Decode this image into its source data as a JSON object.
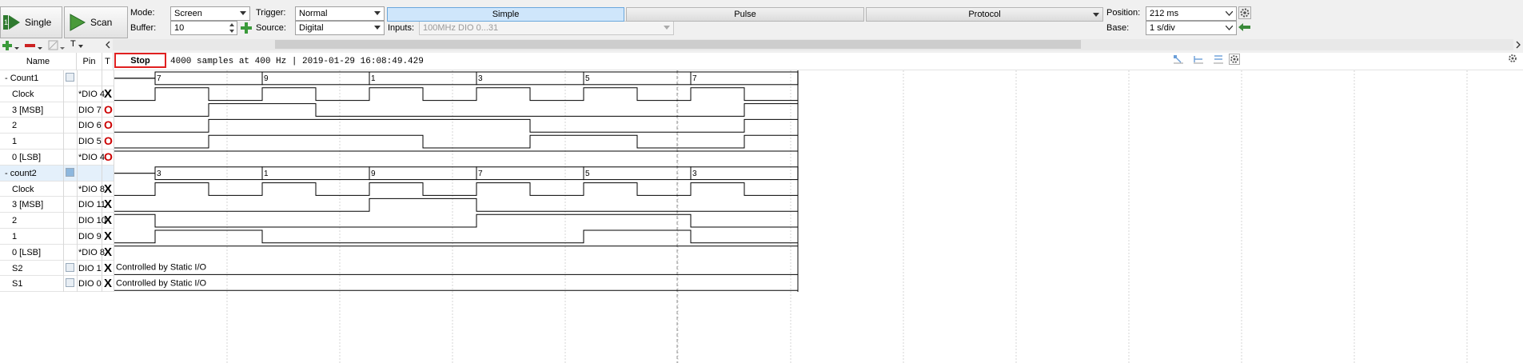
{
  "toolbar": {
    "single_label": "Single",
    "scan_label": "Scan",
    "mode_label": "Mode:",
    "mode_value": "Screen",
    "buffer_label": "Buffer:",
    "buffer_value": "10",
    "trigger_label": "Trigger:",
    "trigger_value": "Normal",
    "source_label": "Source:",
    "source_value": "Digital",
    "inputs_label": "Inputs:",
    "inputs_value": "100MHz DIO 0...31",
    "tabs": [
      "Simple",
      "Pulse",
      "Protocol"
    ],
    "position_label": "Position:",
    "position_value": "212 ms",
    "base_label": "Base:",
    "base_value": "1 s/div"
  },
  "subtoolbar": {
    "text_tool": "T"
  },
  "header": {
    "name": "Name",
    "pin": "Pin",
    "t": "T",
    "stop": "Stop",
    "status": "4000 samples at 400 Hz | 2019-01-29 16:08:49.429"
  },
  "rows": [
    {
      "name": "- Count1",
      "pin": "",
      "t": "",
      "kind": "bus",
      "group": true
    },
    {
      "name": "Clock",
      "pin": "*DIO 4",
      "t": "X",
      "kind": "clock",
      "levels": [
        0,
        1,
        0,
        1,
        0,
        1,
        0,
        1,
        0,
        1,
        0,
        1,
        0
      ]
    },
    {
      "name": "3 [MSB]",
      "pin": "DIO 7",
      "t": "O",
      "kind": "sig",
      "levels": [
        0,
        0,
        1,
        1,
        0,
        0,
        0,
        0,
        0,
        0,
        0,
        0,
        1
      ]
    },
    {
      "name": "2",
      "pin": "DIO 6",
      "t": "O",
      "kind": "sig",
      "levels": [
        0,
        0,
        1,
        1,
        1,
        1,
        1,
        1,
        0,
        0,
        0,
        0,
        1
      ]
    },
    {
      "name": "1",
      "pin": "DIO 5",
      "t": "O",
      "kind": "sig",
      "levels": [
        0,
        0,
        1,
        1,
        1,
        1,
        0,
        0,
        1,
        1,
        0,
        0,
        1
      ]
    },
    {
      "name": "0 [LSB]",
      "pin": "*DIO 4",
      "t": "O",
      "kind": "sig",
      "levels": [
        1,
        1,
        1,
        1,
        1,
        1,
        1,
        1,
        1,
        1,
        1,
        1,
        1
      ]
    },
    {
      "name": "- count2",
      "pin": "",
      "t": "",
      "kind": "bus",
      "group": true
    },
    {
      "name": "Clock",
      "pin": "*DIO 8",
      "t": "X",
      "kind": "clock",
      "levels": [
        0,
        1,
        0,
        1,
        0,
        1,
        0,
        1,
        0,
        1,
        0,
        1,
        0
      ]
    },
    {
      "name": "3 [MSB]",
      "pin": "DIO 11",
      "t": "X",
      "kind": "sig",
      "levels": [
        0,
        0,
        0,
        0,
        0,
        1,
        1,
        0,
        0,
        0,
        0,
        0,
        0
      ]
    },
    {
      "name": "2",
      "pin": "DIO 10",
      "t": "X",
      "kind": "sig",
      "levels": [
        1,
        0,
        0,
        0,
        0,
        0,
        0,
        1,
        1,
        1,
        1,
        0,
        0
      ]
    },
    {
      "name": "1",
      "pin": "DIO 9",
      "t": "X",
      "kind": "sig",
      "levels": [
        0,
        1,
        1,
        0,
        0,
        0,
        0,
        0,
        0,
        1,
        1,
        0,
        0
      ]
    },
    {
      "name": "0 [LSB]",
      "pin": "*DIO 8",
      "t": "X",
      "kind": "sig",
      "levels": [
        1,
        1,
        1,
        1,
        1,
        1,
        1,
        1,
        1,
        1,
        1,
        1,
        1
      ]
    },
    {
      "name": "S2",
      "pin": "DIO 1",
      "t": "X",
      "kind": "static",
      "text": "Controlled by Static I/O"
    },
    {
      "name": "S1",
      "pin": "DIO 0",
      "t": "X",
      "kind": "static",
      "text": "Controlled by Static I/O"
    }
  ],
  "bus_values": {
    "count1": [
      "7",
      "9",
      "1",
      "3",
      "5",
      "7"
    ],
    "count2": [
      "3",
      "1",
      "9",
      "7",
      "5",
      "3"
    ]
  },
  "colors": {
    "accent": "#cfe6fb",
    "trigger": "#cc0000",
    "grid": "#b8b8b8"
  }
}
